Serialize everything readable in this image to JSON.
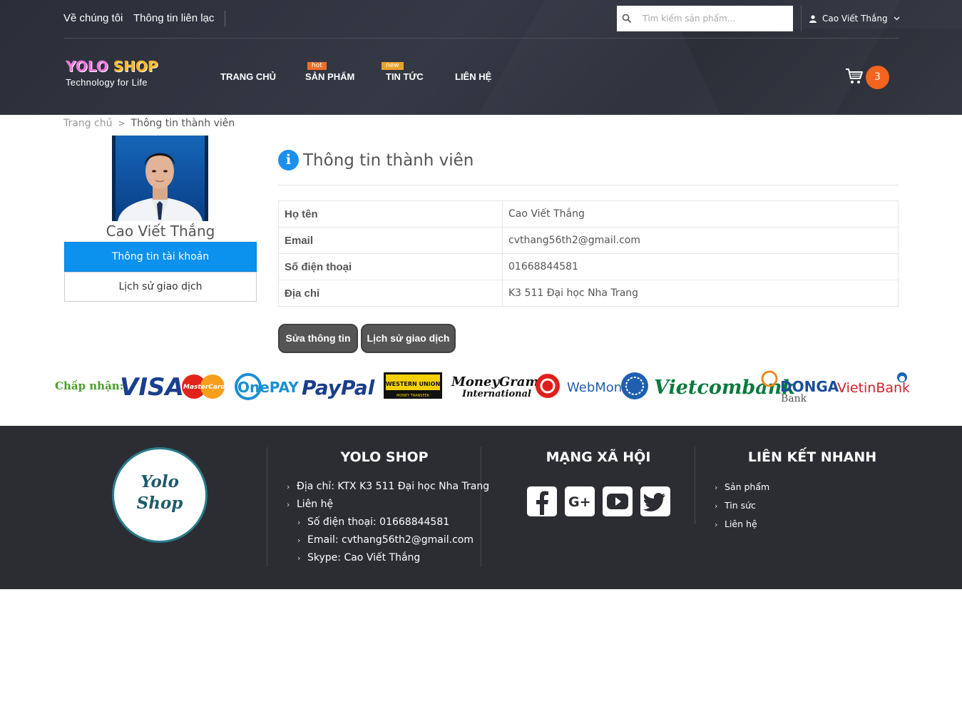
{
  "header": {
    "top_links": [
      "Về chúng tôi",
      "Thông tin liên lạc"
    ],
    "search_placeholder": "Tìm kiếm sản phẩm...",
    "user_name": "Cao Viết Thắng",
    "logo_word1": "YOLO",
    "logo_word2": "SHOP",
    "logo_tagline": "Technology for Life",
    "nav": [
      {
        "label": "TRANG CHỦ",
        "badge": ""
      },
      {
        "label": "SẢN PHẨM",
        "badge": "hot"
      },
      {
        "label": "TIN TỨC",
        "badge": "new"
      },
      {
        "label": "LIÊN HỆ",
        "badge": ""
      }
    ],
    "cart_count": "3"
  },
  "breadcrumb": {
    "home": "Trang chủ",
    "separator": ">",
    "current": "Thông tin thành viên"
  },
  "sidebar": {
    "member_name": "Cao Viết Thắng",
    "menu": [
      "Thông tin tài khoản",
      "Lịch sử giao dịch"
    ]
  },
  "main": {
    "title": "Thông tin thành viên",
    "rows": [
      {
        "label": "Họ tên",
        "value": "Cao Viết Thắng"
      },
      {
        "label": "Email",
        "value": "cvthang56th2@gmail.com"
      },
      {
        "label": "Số điện thoại",
        "value": "01668844581"
      },
      {
        "label": "Địa chỉ",
        "value": "K3 511 Đại học Nha Trang"
      }
    ],
    "buttons": [
      "Sửa thông tin",
      "Lịch sử giao dịch"
    ]
  },
  "payments": {
    "label": "Chấp nhận:",
    "logos": [
      "VISA",
      "MasterCard",
      "OnePAY",
      "PayPal",
      "WESTERN UNION",
      "MONEY TRANSFER",
      "MoneyGram",
      "International",
      "WebMoney",
      "Vietcombank",
      "DONGA",
      "Bank",
      "VietinBank"
    ]
  },
  "footer": {
    "logo_line1": "Yolo",
    "logo_line2": "Shop",
    "shop_title": "YOLO SHOP",
    "shop_items": [
      "Địa chỉ: KTX K3 511 Đại học Nha Trang",
      "Liên hệ",
      "Số điện thoại: 01668844581",
      "Email: cvthang56th2@gmail.com",
      "Skype: Cao Viết Thắng"
    ],
    "social_title": "MẠNG XÃ HỘI",
    "social_icons": [
      "facebook-icon",
      "google-plus-icon",
      "youtube-icon",
      "twitter-icon"
    ],
    "links_title": "LIÊN KẾT NHANH",
    "links": [
      "Sản phẩm",
      "Tin sức",
      "Liên hệ"
    ]
  },
  "colors": {
    "header_bg": "#2f323c",
    "accent_blue": "#0b91ee",
    "cart_badge": "#f5641e",
    "footer_bg": "#2c2d33",
    "accept_label": "#4b9e2b"
  }
}
